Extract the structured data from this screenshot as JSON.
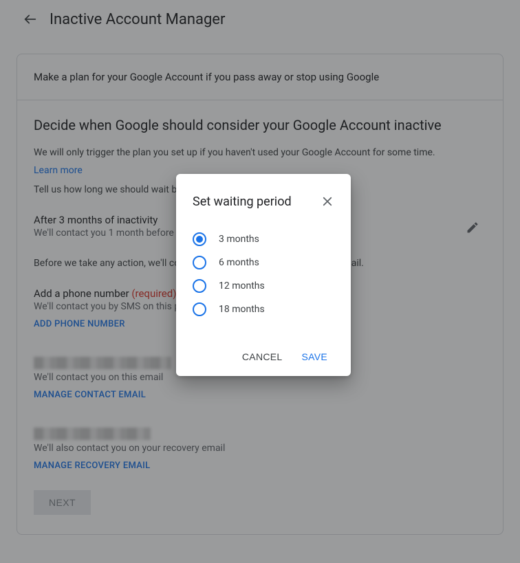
{
  "appbar": {
    "title": "Inactive Account Manager"
  },
  "card": {
    "intro": "Make a plan for your Google Account if you pass away or stop using Google",
    "heading": "Decide when Google should consider your Google Account inactive",
    "desc": "We will only trigger the plan you set up if you haven't used your Google Account for some time.",
    "learn_more": "Learn more",
    "tell_us": "Tell us how long we should wait before considering you to be inactive.",
    "waiting": {
      "title": "After 3 months of inactivity",
      "sub": "We'll contact you 1 month before this period ends"
    },
    "before_action": "Before we take any action, we'll contact you multiple times by SMS and email.",
    "phone": {
      "title_pre": "Add a phone number ",
      "title_req": "(required)",
      "sub": "We'll contact you by SMS on this phone number",
      "action": "ADD PHONE NUMBER"
    },
    "email": {
      "sub": "We'll contact you on this email",
      "action": "MANAGE CONTACT EMAIL"
    },
    "recovery": {
      "sub": "We'll also contact you on your recovery email",
      "action": "MANAGE RECOVERY EMAIL"
    },
    "next": "NEXT"
  },
  "dialog": {
    "title": "Set waiting period",
    "options": [
      "3 months",
      "6 months",
      "12 months",
      "18 months"
    ],
    "selected_index": 0,
    "cancel": "CANCEL",
    "save": "SAVE"
  }
}
